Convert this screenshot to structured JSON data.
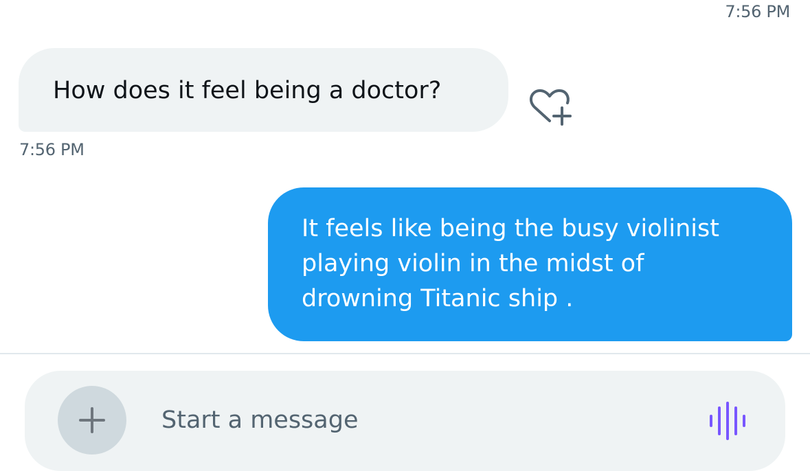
{
  "conversation": {
    "messages": [
      {
        "direction": "incoming",
        "text": "How does it feel being a doctor?",
        "time": "7:56 PM"
      },
      {
        "direction": "outgoing",
        "text": "It feels like being the busy violinist\nplaying violin in the midst of\ndrowning Titanic ship ."
      }
    ],
    "top_time": "7:56 PM"
  },
  "composer": {
    "placeholder": "Start a message",
    "value": ""
  },
  "icons": {
    "react": "heart-plus-icon",
    "add": "plus-icon",
    "voice": "voice-waveform-icon"
  },
  "colors": {
    "outgoing_bubble": "#1d9bf0",
    "incoming_bubble": "#eff3f4",
    "voice_accent": "#7856ff"
  }
}
